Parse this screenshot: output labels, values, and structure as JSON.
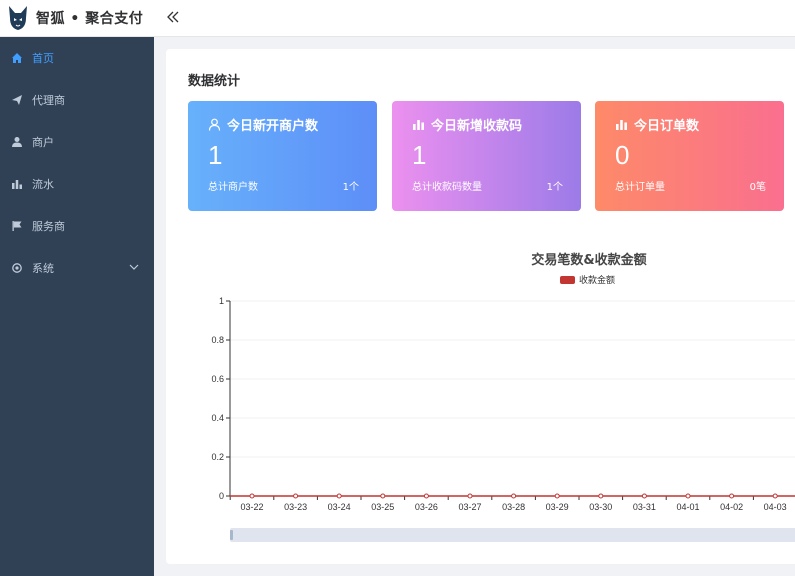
{
  "app": {
    "brand": "智狐 • 聚合支付"
  },
  "sidebar": {
    "items": [
      {
        "label": "首页",
        "icon": "home-icon",
        "active": true
      },
      {
        "label": "代理商",
        "icon": "send-icon",
        "active": false
      },
      {
        "label": "商户",
        "icon": "user-icon",
        "active": false
      },
      {
        "label": "流水",
        "icon": "bar-chart-icon",
        "active": false
      },
      {
        "label": "服务商",
        "icon": "flag-icon",
        "active": false
      },
      {
        "label": "系统",
        "icon": "settings-icon",
        "active": false
      }
    ]
  },
  "main": {
    "section_title": "数据统计",
    "cards": [
      {
        "title": "今日新开商户数",
        "value": "1",
        "foot_label": "总计商户数",
        "foot_value": "1个",
        "icon": "user-icon"
      },
      {
        "title": "今日新增收款码",
        "value": "1",
        "foot_label": "总计收款码数量",
        "foot_value": "1个",
        "icon": "bar-chart-icon"
      },
      {
        "title": "今日订单数",
        "value": "0",
        "foot_label": "总计订单量",
        "foot_value": "0笔",
        "icon": "bar-chart-icon"
      }
    ]
  },
  "colors": {
    "sidebar_bg": "#304156",
    "active": "#409eff",
    "series": "#c23531"
  },
  "chart_data": {
    "type": "line",
    "title": "交易笔数&收款金额",
    "x": [
      "03-22",
      "03-23",
      "03-24",
      "03-25",
      "03-26",
      "03-27",
      "03-28",
      "03-29",
      "03-30",
      "03-31",
      "04-01",
      "04-02",
      "04-03"
    ],
    "series": [
      {
        "name": "收款金额",
        "values": [
          0,
          0,
          0,
          0,
          0,
          0,
          0,
          0,
          0,
          0,
          0,
          0,
          0
        ],
        "color": "#c23531"
      }
    ],
    "yticks": [
      "0",
      "0.2",
      "0.4",
      "0.6",
      "0.8",
      "1"
    ],
    "ylim": [
      0,
      1
    ],
    "legend": "top-center",
    "grid": true
  }
}
